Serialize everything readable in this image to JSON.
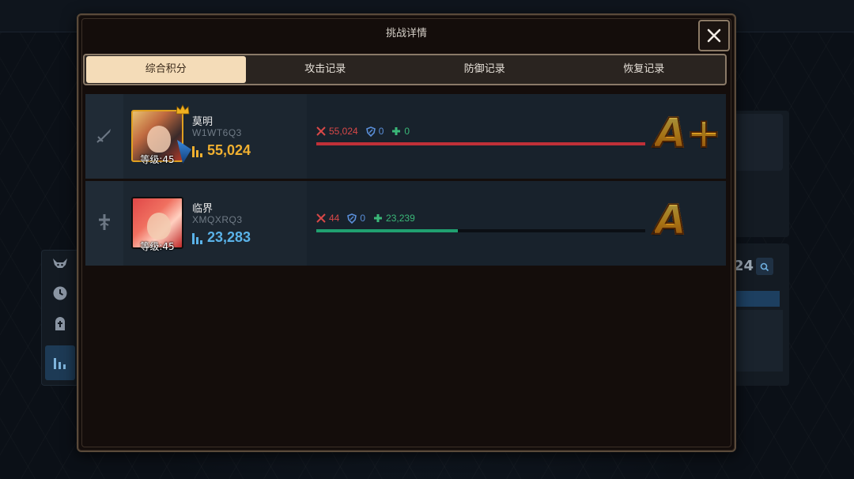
{
  "dialog": {
    "title": "挑战详情",
    "close_icon": "close-icon"
  },
  "tabs": [
    {
      "label": "综合积分",
      "active": true
    },
    {
      "label": "攻击记录",
      "active": false
    },
    {
      "label": "防御记录",
      "active": false
    },
    {
      "label": "恢复记录",
      "active": false
    }
  ],
  "players": [
    {
      "role_icon": "sword-icon",
      "name": "莫明",
      "id": "W1WT6Q3",
      "level": "等级:45",
      "score": "55,024",
      "attack": "55,024",
      "defense": "0",
      "heal": "0",
      "bar_fraction": 1.0,
      "bar_type": "attack",
      "grade": "A+"
    },
    {
      "role_icon": "healer-icon",
      "name": "临界",
      "id": "XMQXRQ3",
      "level": "等级:45",
      "score": "23,283",
      "attack": "44",
      "defense": "0",
      "heal": "23,239",
      "bar_fraction": 0.43,
      "bar_type": "heal",
      "grade": "A"
    }
  ],
  "background": {
    "right_value": "24",
    "left_rail_icons": [
      "demon-icon",
      "clock-icon",
      "tombstone-icon",
      "bar-chart-icon"
    ]
  },
  "colors": {
    "attack": "#d84848",
    "defense": "#5a8ed8",
    "heal": "#3ab878",
    "active_tab": "#f4dcb8",
    "grade": "#ffb020"
  }
}
